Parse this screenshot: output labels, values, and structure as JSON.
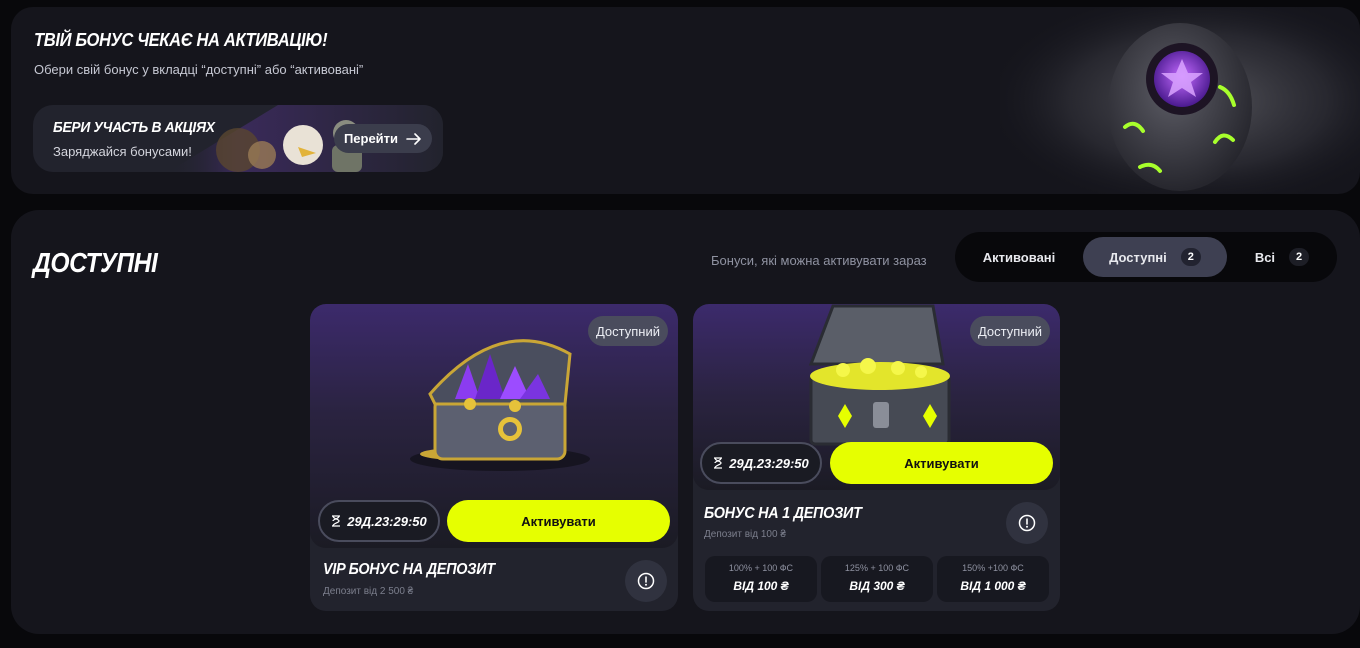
{
  "banner": {
    "title": "ТВІЙ БОНУС ЧЕКАЄ НА АКТИВАЦІЮ!",
    "subtitle": "Обери свій бонус у вкладці “доступні” або “активовані”",
    "promo": {
      "title": "БЕРИ УЧАСТЬ В АКЦІЯХ",
      "subtitle": "Заряджайся бонусами!",
      "button_label": "Перейти"
    }
  },
  "section": {
    "title": "ДОСТУПНІ",
    "hint": "Бонуси, які можна активувати зараз",
    "tabs": [
      {
        "label": "Активовані",
        "count": ""
      },
      {
        "label": "Доступні",
        "count": "2"
      },
      {
        "label": "Всі",
        "count": "2"
      }
    ]
  },
  "cards": [
    {
      "status": "Доступний",
      "timer": "29Д.23:29:50",
      "activate_label": "Активувати",
      "name": "VIP БОНУС НА ДЕПОЗИТ",
      "deposit": "Депозит від 2 500 ₴"
    },
    {
      "status": "Доступний",
      "timer": "29Д.23:29:50",
      "activate_label": "Активувати",
      "name": "БОНУС НА 1 ДЕПОЗИТ",
      "deposit": "Депозит від 100 ₴",
      "tiers": [
        {
          "offer": "100% + 100 ФС",
          "min": "ВІД 100 ₴"
        },
        {
          "offer": "125% + 100 ФС",
          "min": "ВІД 300 ₴"
        },
        {
          "offer": "150% +100 ФС",
          "min": "ВІД 1 000 ₴"
        }
      ]
    }
  ],
  "colors": {
    "accent": "#e6ff00",
    "panel": "#15151c",
    "card": "#22232d",
    "purple": "#6a3fd0"
  },
  "icons": [
    "arrow-right-icon",
    "hourglass-icon",
    "info-icon",
    "treasure-chest-icon",
    "dragon-egg-icon"
  ]
}
